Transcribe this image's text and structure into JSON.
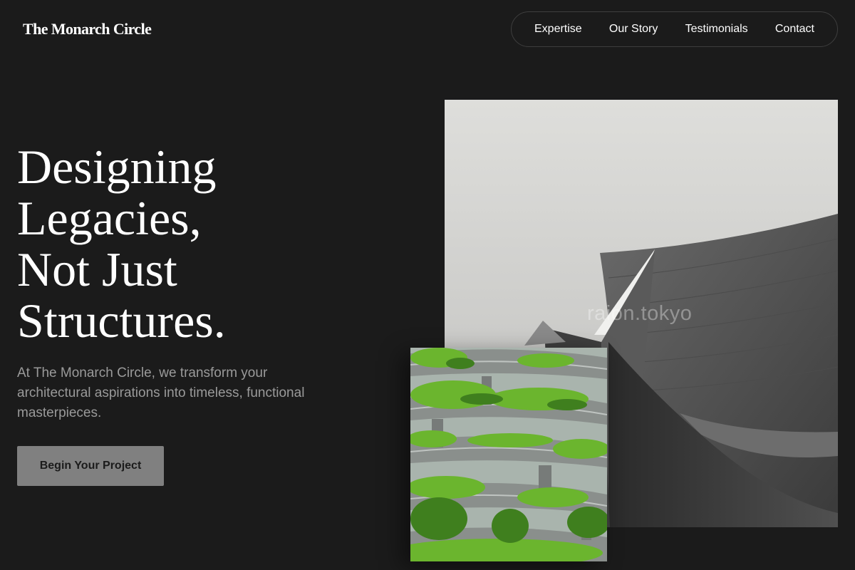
{
  "header": {
    "brand": "The Monarch Circle",
    "nav": [
      "Expertise",
      "Our Story",
      "Testimonials",
      "Contact"
    ]
  },
  "hero": {
    "title_lines": [
      "Designing",
      "Legacies,",
      "Not Just",
      "Structures."
    ],
    "subtitle": "At The Monarch Circle, we transform your architectural aspirations into timeless, functional masterpieces.",
    "cta_label": "Begin Your Project"
  },
  "images": {
    "main_alt": "Monochrome curved metal building against grey sky",
    "main_watermark": "raion.tokyo",
    "secondary_alt": "Tiered building with lush green terraces"
  },
  "colors": {
    "background": "#1b1b1b",
    "text": "#ffffff",
    "muted_text": "#9a9a9a",
    "button_bg": "#808080",
    "nav_border": "#3e3e3e"
  }
}
